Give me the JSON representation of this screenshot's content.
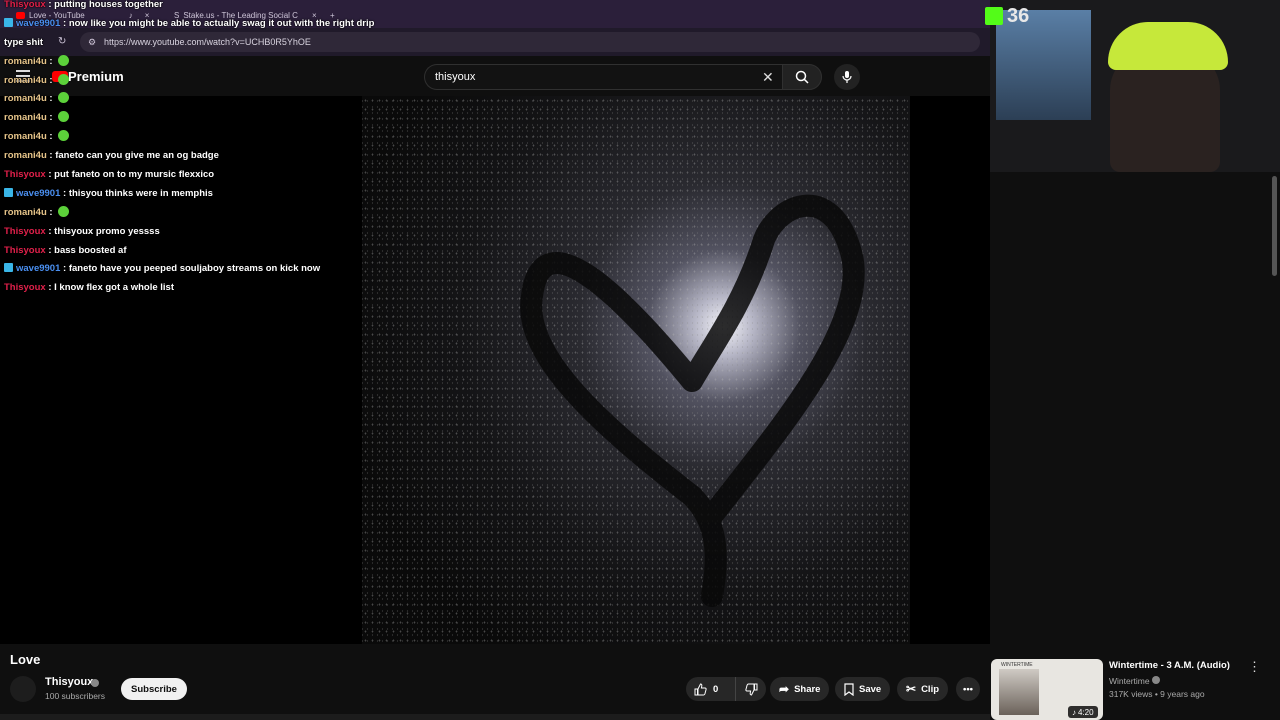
{
  "browser": {
    "tabs": [
      {
        "label": "Love - YouTube"
      },
      {
        "label": "Stake.us - The Leading Social C"
      }
    ],
    "url": "https://www.youtube.com/watch?v=UCHB0R5YhOE"
  },
  "youtube": {
    "logo_text": "Premium",
    "search_value": "thisyoux"
  },
  "chat": [
    {
      "user": "Thisyoux",
      "color": "#e0204a",
      "badge": false,
      "text": "putting houses together",
      "emote": false
    },
    {
      "user": "wave9901",
      "color": "#4a8ff0",
      "badge": true,
      "text": "now like you might be able to actually swag it out with the right drip",
      "emote": false
    },
    {
      "user": "",
      "color": "#ffffff",
      "badge": false,
      "text": "type shit",
      "emote": false
    },
    {
      "user": "romani4u",
      "color": "#e7c58a",
      "badge": false,
      "text": "",
      "emote": true
    },
    {
      "user": "romani4u",
      "color": "#e7c58a",
      "badge": false,
      "text": "",
      "emote": true
    },
    {
      "user": "romani4u",
      "color": "#e7c58a",
      "badge": false,
      "text": "",
      "emote": true
    },
    {
      "user": "romani4u",
      "color": "#e7c58a",
      "badge": false,
      "text": "",
      "emote": true
    },
    {
      "user": "romani4u",
      "color": "#e7c58a",
      "badge": false,
      "text": "",
      "emote": true
    },
    {
      "user": "romani4u",
      "color": "#e7c58a",
      "badge": false,
      "text": "faneto can you give me an og badge",
      "emote": false
    },
    {
      "user": "Thisyoux",
      "color": "#e0204a",
      "badge": false,
      "text": "put faneto on to my mursic flexxico",
      "emote": false
    },
    {
      "user": "wave9901",
      "color": "#4a8ff0",
      "badge": true,
      "text": "thisyou thinks were in memphis",
      "emote": false
    },
    {
      "user": "romani4u",
      "color": "#e7c58a",
      "badge": false,
      "text": "",
      "emote": true
    },
    {
      "user": "Thisyoux",
      "color": "#e0204a",
      "badge": false,
      "text": "thisyoux promo yessss",
      "emote": false
    },
    {
      "user": "Thisyoux",
      "color": "#e0204a",
      "badge": false,
      "text": "bass boosted af",
      "emote": false
    },
    {
      "user": "wave9901",
      "color": "#4a8ff0",
      "badge": true,
      "text": "faneto have you peeped souljaboy streams on kick now",
      "emote": false
    },
    {
      "user": "Thisyoux",
      "color": "#e0204a",
      "badge": false,
      "text": "I know flex got a whole list",
      "emote": false
    }
  ],
  "stream": {
    "viewer_count": "36"
  },
  "video": {
    "title": "Love",
    "channel": "Thisyoux",
    "subscribers": "100 subscribers",
    "subscribe_label": "Subscribe",
    "like_count": "0",
    "share_label": "Share",
    "save_label": "Save",
    "clip_label": "Clip"
  },
  "recommended": {
    "title": "Wintertime - 3 A.M. (Audio)",
    "channel": "Wintertime",
    "meta": "317K views • 9 years ago",
    "duration": "4:20",
    "thumb_text": "WINTERTIME"
  }
}
